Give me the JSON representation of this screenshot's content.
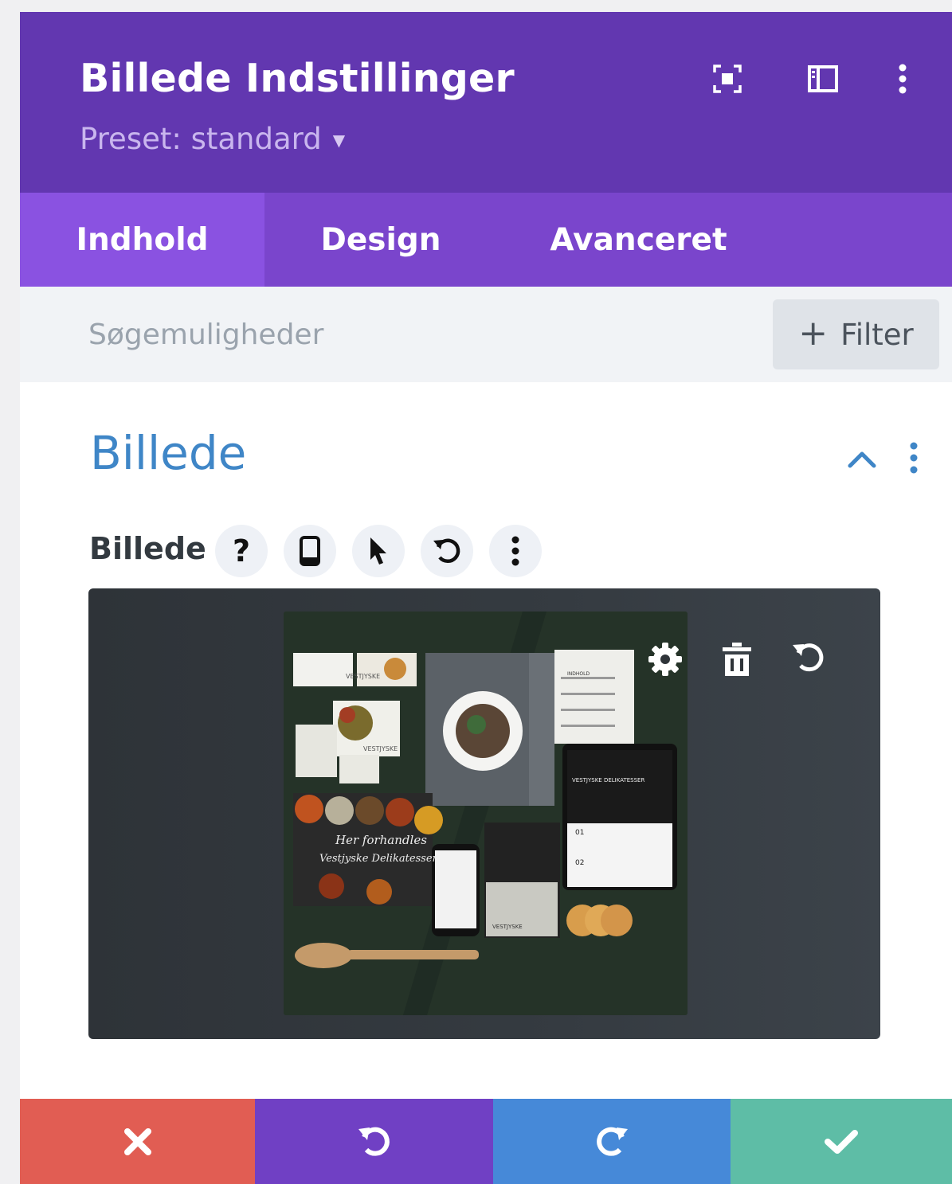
{
  "header": {
    "title": "Billede Indstillinger",
    "preset_label": "Preset: standard",
    "icons": [
      "fullscreen-icon",
      "sidebar-layout-icon",
      "more-vertical-icon"
    ]
  },
  "tabs": [
    {
      "label": "Indhold",
      "active": true
    },
    {
      "label": "Design",
      "active": false
    },
    {
      "label": "Avanceret",
      "active": false
    }
  ],
  "search": {
    "placeholder": "Søgemuligheder",
    "value": "",
    "filter_label": "Filter"
  },
  "section": {
    "title": "Billede",
    "field": {
      "label": "Billede",
      "tools": [
        "help-icon",
        "mobile-icon",
        "cursor-icon",
        "reset-icon",
        "more-vertical-icon"
      ]
    },
    "image_overlay_icons": [
      "gear-icon",
      "trash-icon",
      "reset-icon"
    ],
    "image_text": {
      "headline_1": "Her forhandles",
      "headline_2": "Vestjyske Delikatesser",
      "brand": "VESTJYSKE",
      "site_heading": "VESTJYSKE DELIKATESSER",
      "menu_title": "INDHOLD",
      "step_1": "01",
      "step_2": "02"
    }
  },
  "footer": {
    "buttons": [
      "close-icon",
      "undo-icon",
      "redo-icon",
      "check-icon"
    ]
  },
  "colors": {
    "header_bg": "#6237b0",
    "tabs_bg": "#7a45cc",
    "tab_active_bg": "#8a52e1",
    "section_title": "#3f86c7",
    "cancel": "#e15d53",
    "undo": "#7040c4",
    "redo": "#4689d8",
    "save": "#5ebda6"
  }
}
